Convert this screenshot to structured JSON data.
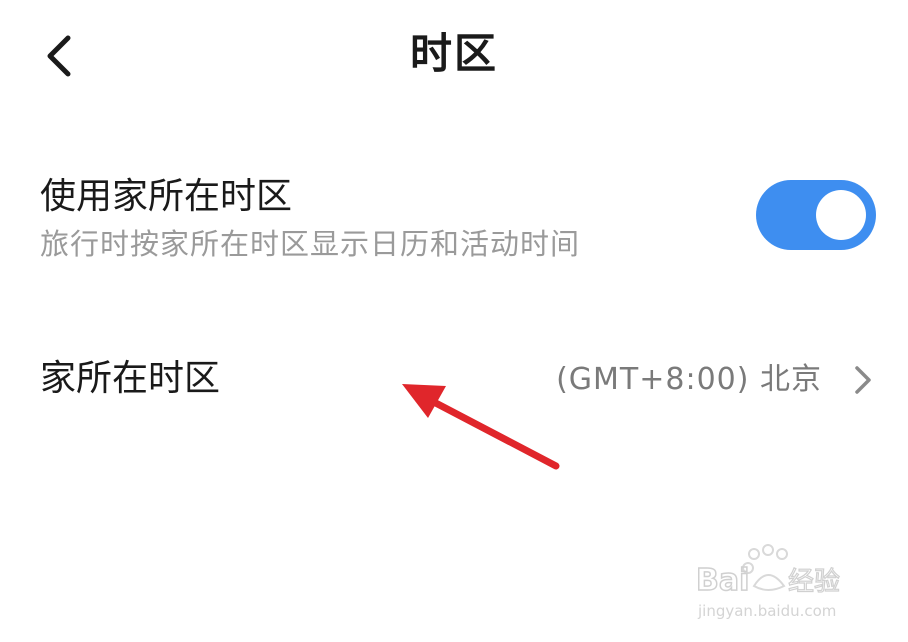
{
  "header": {
    "title": "时区",
    "back_icon": "chevron-left-icon"
  },
  "settings": {
    "use_home_timezone": {
      "title": "使用家所在时区",
      "subtitle": "旅行时按家所在时区显示日历和活动时间",
      "enabled": true,
      "toggle_color": "#3e8ef0"
    },
    "home_timezone": {
      "title": "家所在时区",
      "value": "(GMT+8:00) 北京",
      "icon": "chevron-right-icon"
    }
  },
  "annotation": {
    "color": "#e0262b"
  },
  "watermark": {
    "brand": "Bai经验",
    "url": "jingyan.baidu.com"
  }
}
